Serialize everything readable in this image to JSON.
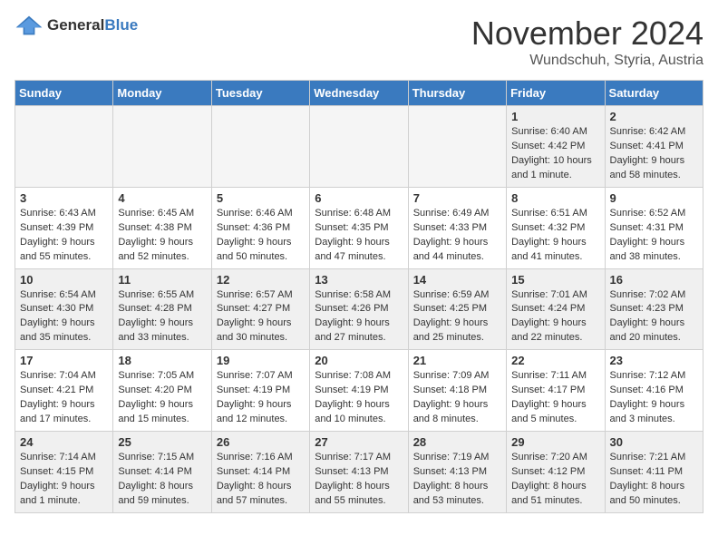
{
  "logo": {
    "general": "General",
    "blue": "Blue"
  },
  "title": "November 2024",
  "location": "Wundschuh, Styria, Austria",
  "days_of_week": [
    "Sunday",
    "Monday",
    "Tuesday",
    "Wednesday",
    "Thursday",
    "Friday",
    "Saturday"
  ],
  "weeks": [
    [
      {
        "day": "",
        "info": "",
        "empty": true
      },
      {
        "day": "",
        "info": "",
        "empty": true
      },
      {
        "day": "",
        "info": "",
        "empty": true
      },
      {
        "day": "",
        "info": "",
        "empty": true
      },
      {
        "day": "",
        "info": "",
        "empty": true
      },
      {
        "day": "1",
        "info": "Sunrise: 6:40 AM\nSunset: 4:42 PM\nDaylight: 10 hours\nand 1 minute."
      },
      {
        "day": "2",
        "info": "Sunrise: 6:42 AM\nSunset: 4:41 PM\nDaylight: 9 hours\nand 58 minutes."
      }
    ],
    [
      {
        "day": "3",
        "info": "Sunrise: 6:43 AM\nSunset: 4:39 PM\nDaylight: 9 hours\nand 55 minutes."
      },
      {
        "day": "4",
        "info": "Sunrise: 6:45 AM\nSunset: 4:38 PM\nDaylight: 9 hours\nand 52 minutes."
      },
      {
        "day": "5",
        "info": "Sunrise: 6:46 AM\nSunset: 4:36 PM\nDaylight: 9 hours\nand 50 minutes."
      },
      {
        "day": "6",
        "info": "Sunrise: 6:48 AM\nSunset: 4:35 PM\nDaylight: 9 hours\nand 47 minutes."
      },
      {
        "day": "7",
        "info": "Sunrise: 6:49 AM\nSunset: 4:33 PM\nDaylight: 9 hours\nand 44 minutes."
      },
      {
        "day": "8",
        "info": "Sunrise: 6:51 AM\nSunset: 4:32 PM\nDaylight: 9 hours\nand 41 minutes."
      },
      {
        "day": "9",
        "info": "Sunrise: 6:52 AM\nSunset: 4:31 PM\nDaylight: 9 hours\nand 38 minutes."
      }
    ],
    [
      {
        "day": "10",
        "info": "Sunrise: 6:54 AM\nSunset: 4:30 PM\nDaylight: 9 hours\nand 35 minutes."
      },
      {
        "day": "11",
        "info": "Sunrise: 6:55 AM\nSunset: 4:28 PM\nDaylight: 9 hours\nand 33 minutes."
      },
      {
        "day": "12",
        "info": "Sunrise: 6:57 AM\nSunset: 4:27 PM\nDaylight: 9 hours\nand 30 minutes."
      },
      {
        "day": "13",
        "info": "Sunrise: 6:58 AM\nSunset: 4:26 PM\nDaylight: 9 hours\nand 27 minutes."
      },
      {
        "day": "14",
        "info": "Sunrise: 6:59 AM\nSunset: 4:25 PM\nDaylight: 9 hours\nand 25 minutes."
      },
      {
        "day": "15",
        "info": "Sunrise: 7:01 AM\nSunset: 4:24 PM\nDaylight: 9 hours\nand 22 minutes."
      },
      {
        "day": "16",
        "info": "Sunrise: 7:02 AM\nSunset: 4:23 PM\nDaylight: 9 hours\nand 20 minutes."
      }
    ],
    [
      {
        "day": "17",
        "info": "Sunrise: 7:04 AM\nSunset: 4:21 PM\nDaylight: 9 hours\nand 17 minutes."
      },
      {
        "day": "18",
        "info": "Sunrise: 7:05 AM\nSunset: 4:20 PM\nDaylight: 9 hours\nand 15 minutes."
      },
      {
        "day": "19",
        "info": "Sunrise: 7:07 AM\nSunset: 4:19 PM\nDaylight: 9 hours\nand 12 minutes."
      },
      {
        "day": "20",
        "info": "Sunrise: 7:08 AM\nSunset: 4:19 PM\nDaylight: 9 hours\nand 10 minutes."
      },
      {
        "day": "21",
        "info": "Sunrise: 7:09 AM\nSunset: 4:18 PM\nDaylight: 9 hours\nand 8 minutes."
      },
      {
        "day": "22",
        "info": "Sunrise: 7:11 AM\nSunset: 4:17 PM\nDaylight: 9 hours\nand 5 minutes."
      },
      {
        "day": "23",
        "info": "Sunrise: 7:12 AM\nSunset: 4:16 PM\nDaylight: 9 hours\nand 3 minutes."
      }
    ],
    [
      {
        "day": "24",
        "info": "Sunrise: 7:14 AM\nSunset: 4:15 PM\nDaylight: 9 hours\nand 1 minute."
      },
      {
        "day": "25",
        "info": "Sunrise: 7:15 AM\nSunset: 4:14 PM\nDaylight: 8 hours\nand 59 minutes."
      },
      {
        "day": "26",
        "info": "Sunrise: 7:16 AM\nSunset: 4:14 PM\nDaylight: 8 hours\nand 57 minutes."
      },
      {
        "day": "27",
        "info": "Sunrise: 7:17 AM\nSunset: 4:13 PM\nDaylight: 8 hours\nand 55 minutes."
      },
      {
        "day": "28",
        "info": "Sunrise: 7:19 AM\nSunset: 4:13 PM\nDaylight: 8 hours\nand 53 minutes."
      },
      {
        "day": "29",
        "info": "Sunrise: 7:20 AM\nSunset: 4:12 PM\nDaylight: 8 hours\nand 51 minutes."
      },
      {
        "day": "30",
        "info": "Sunrise: 7:21 AM\nSunset: 4:11 PM\nDaylight: 8 hours\nand 50 minutes."
      }
    ]
  ]
}
